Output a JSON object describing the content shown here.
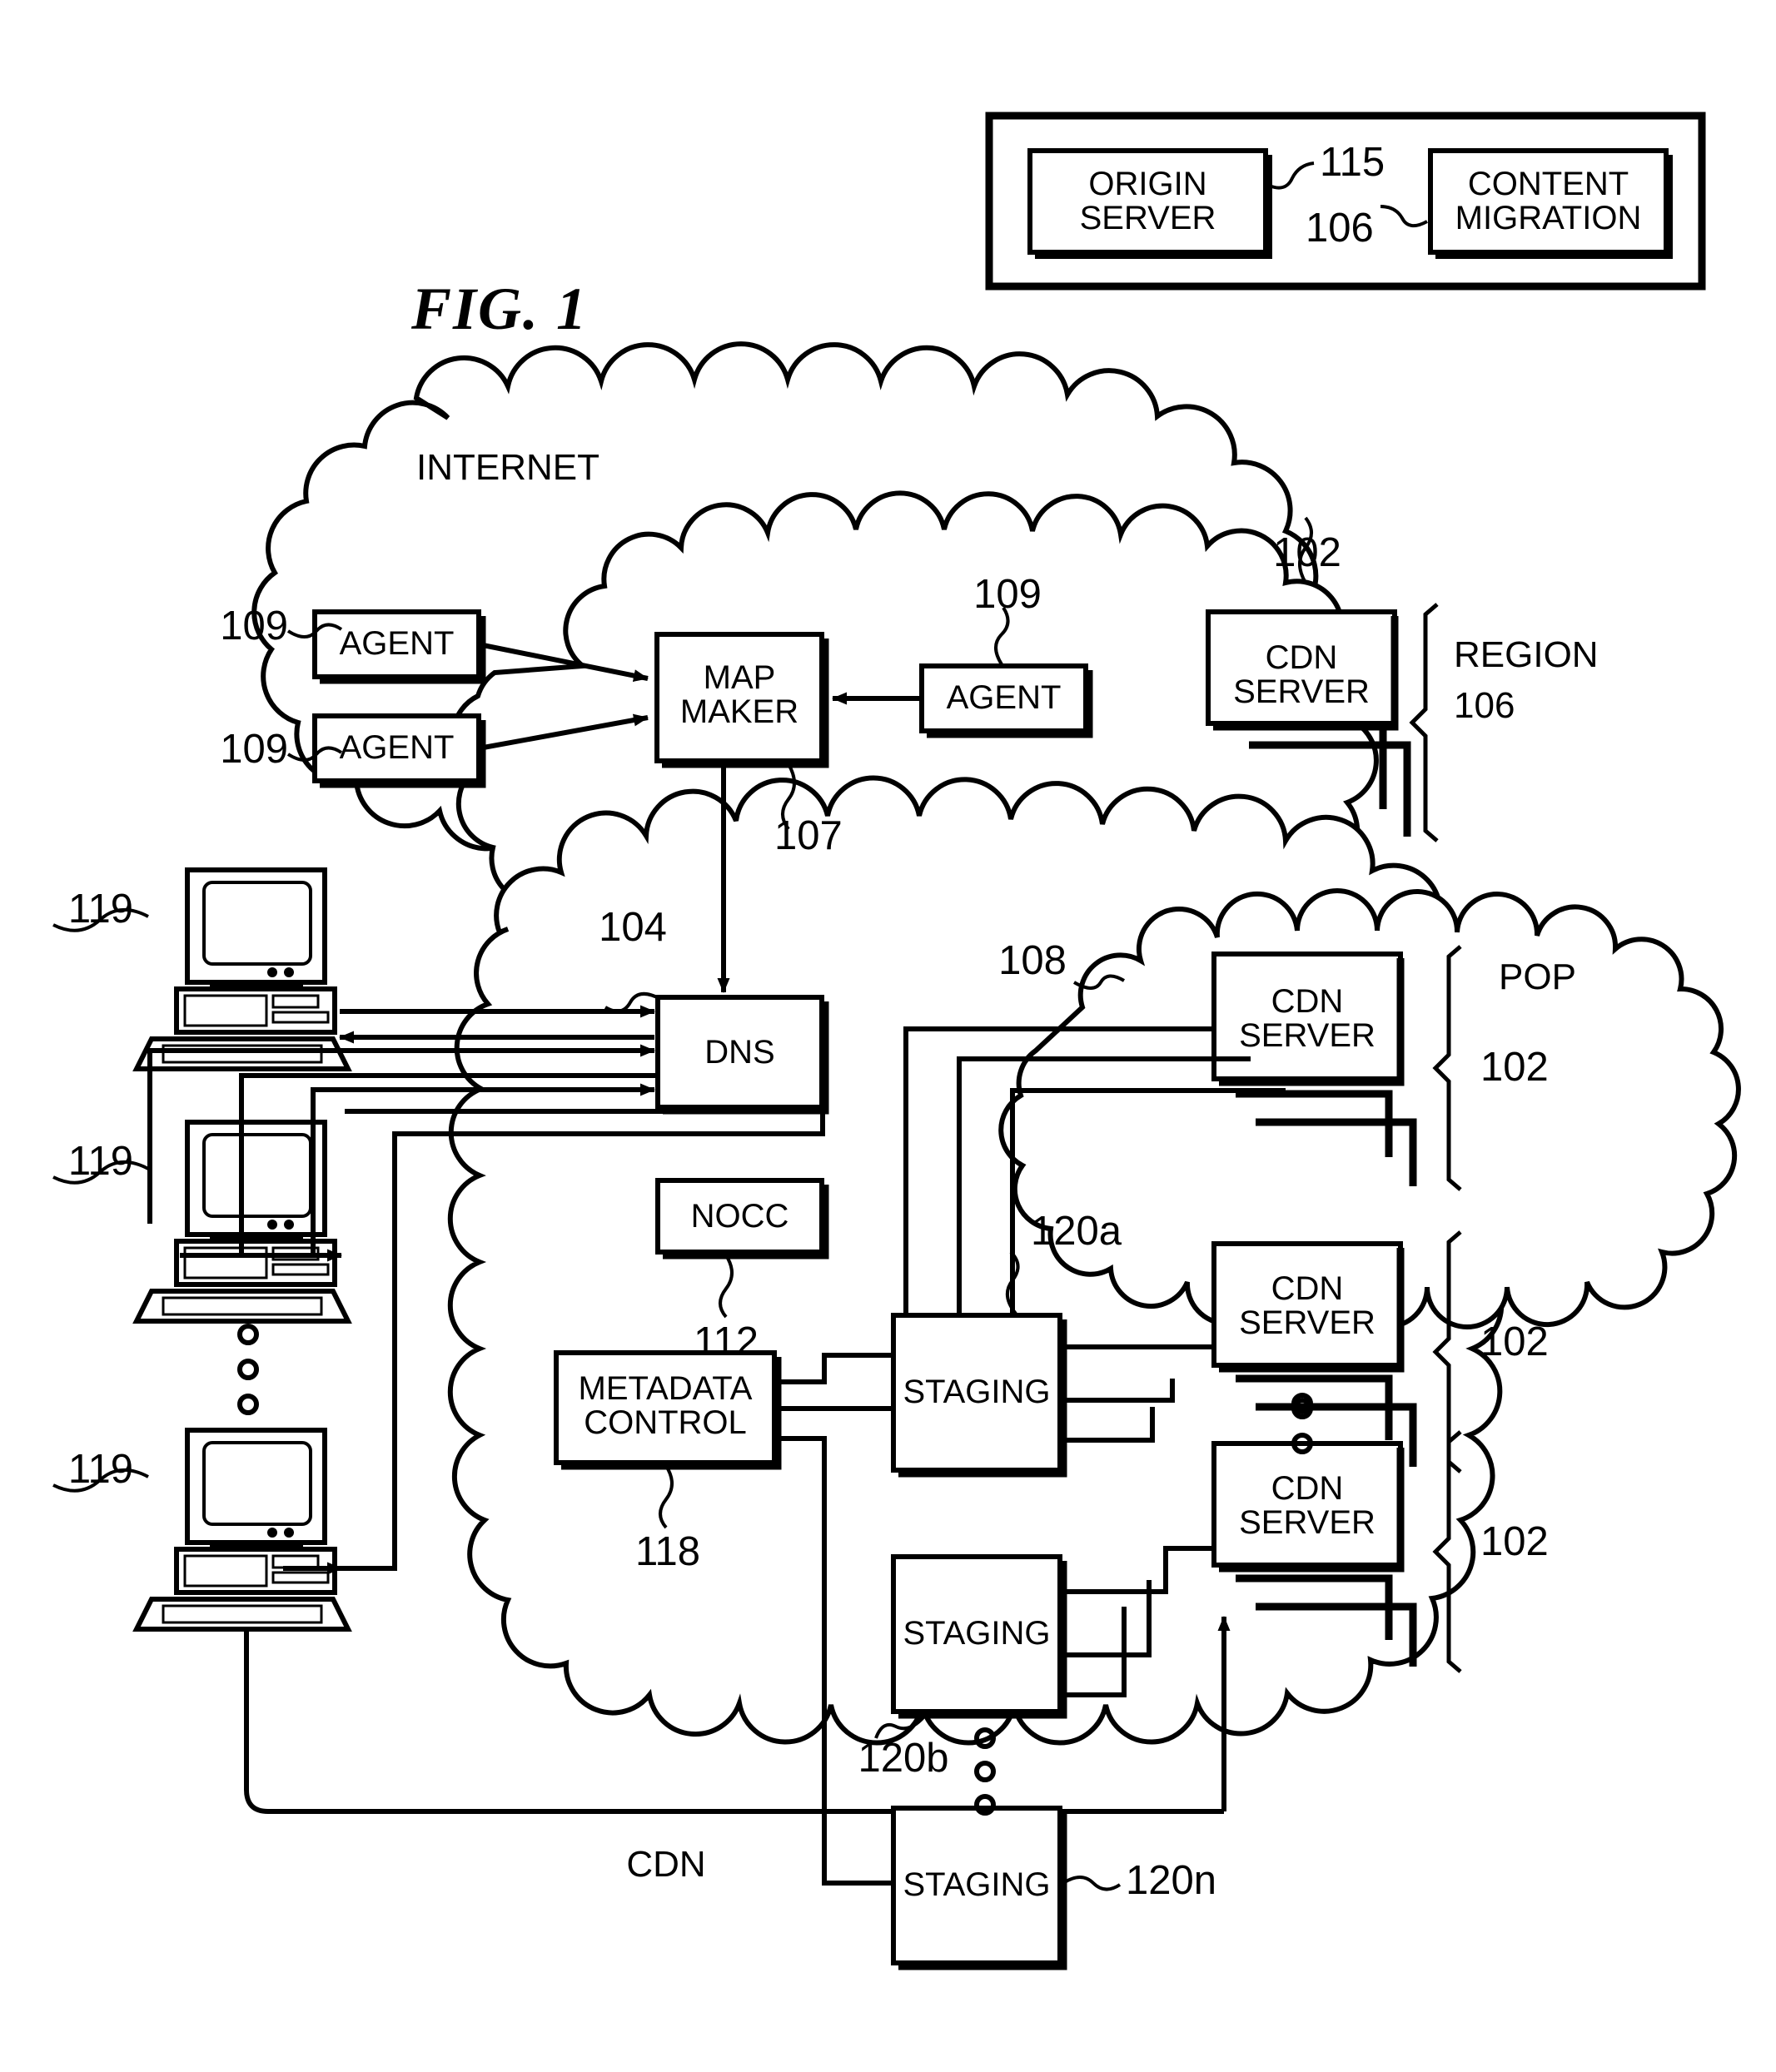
{
  "figure": {
    "title": "FIG. 1",
    "domain_note": "patent diagram"
  },
  "legend_panel": {
    "origin_server": "ORIGIN\nSERVER",
    "content_migration": "CONTENT\nMIGRATION",
    "ref_115": "115",
    "ref_106": "106"
  },
  "internet_cloud": {
    "label": "INTERNET",
    "agents": [
      {
        "label": "AGENT",
        "ref": "109"
      },
      {
        "label": "AGENT",
        "ref": "109"
      },
      {
        "label": "AGENT",
        "ref": "109"
      }
    ],
    "map_maker": {
      "label": "MAP\nMAKER",
      "ref": "107"
    },
    "region": {
      "cdn_server": "CDN\nSERVER",
      "ref_102": "102",
      "region_label": "REGION",
      "region_ref": "106"
    }
  },
  "cdn_cloud": {
    "label": "CDN",
    "dns": {
      "label": "DNS",
      "ref": "104"
    },
    "nocc": {
      "label": "NOCC",
      "ref": "112"
    },
    "metadata_control": {
      "label": "METADATA\nCONTROL",
      "ref": "118"
    },
    "staging": [
      {
        "label": "STAGING",
        "ref": "120a"
      },
      {
        "label": "STAGING",
        "ref": "120b"
      },
      {
        "label": "STAGING",
        "ref": "120n"
      }
    ],
    "pop": {
      "label": "POP",
      "ref": "108",
      "cdn_server": "CDN\nSERVER",
      "ref_102": "102"
    },
    "server_groups": [
      {
        "cdn_server": "CDN\nSERVER",
        "ref_102": "102"
      },
      {
        "cdn_server": "CDN\nSERVER",
        "ref_102": "102"
      }
    ]
  },
  "clients": [
    {
      "ref": "119"
    },
    {
      "ref": "119"
    },
    {
      "ref": "119"
    }
  ],
  "colors": {
    "ink": "#000000",
    "paper": "#ffffff"
  }
}
